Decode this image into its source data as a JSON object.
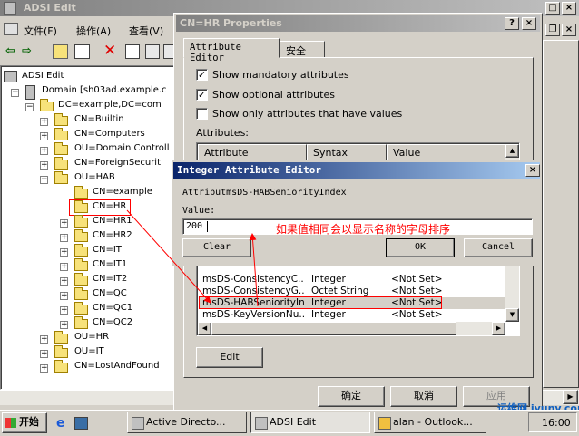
{
  "main_window": {
    "title": "ADSI Edit",
    "menu": [
      {
        "label": "文件(F)"
      },
      {
        "label": "操作(A)"
      },
      {
        "label": "查看(V)"
      }
    ],
    "tree": {
      "root": "ADSI Edit",
      "domain": "Domain [sh03ad.example.c",
      "dc": "DC=example,DC=com",
      "items": [
        "CN=Builtin",
        "CN=Computers",
        "OU=Domain Controll",
        "CN=ForeignSecurit",
        "OU=HAB"
      ],
      "hab_children": [
        "CN=example",
        "CN=HR",
        "CN=HR1",
        "CN=HR2",
        "CN=IT",
        "CN=IT1",
        "CN=IT2",
        "CN=QC",
        "CN=QC1",
        "CN=QC2"
      ],
      "after": [
        "OU=HR",
        "OU=IT",
        "CN=LostAndFound"
      ]
    }
  },
  "properties_dialog": {
    "title": "CN=HR Properties",
    "tabs": [
      "Attribute Editor",
      "安全"
    ],
    "checks": [
      {
        "label": "Show mandatory attributes",
        "checked": true
      },
      {
        "label": "Show optional attributes",
        "checked": true
      },
      {
        "label": "Show only attributes that have values",
        "checked": false
      }
    ],
    "attributes_label": "Attributes:",
    "columns": [
      "Attribute",
      "Syntax",
      "Value"
    ],
    "rows": [
      {
        "attr": "msDS-ConsistencyC...",
        "syntax": "Integer",
        "value": "<Not Set>"
      },
      {
        "attr": "msDS-ConsistencyG...",
        "syntax": "Octet String",
        "value": "<Not Set>"
      },
      {
        "attr": "msDS-HABSeniorityIn...",
        "syntax": "Integer",
        "value": "<Not Set>"
      },
      {
        "attr": "msDS-KeyVersionNu...",
        "syntax": "Integer",
        "value": "<Not Set>"
      }
    ],
    "edit_label": "Edit",
    "ok_label": "确定",
    "cancel_label": "取消",
    "apply_label": "应用"
  },
  "int_editor": {
    "title": "Integer Attribute Editor",
    "attribute_line": "AttributmsDS-HABSeniorityIndex",
    "value_label": "Value:",
    "value": "200",
    "clear_label": "Clear",
    "ok_label": "OK",
    "cancel_label": "Cancel"
  },
  "annotation": {
    "text": "如果值相同会以显示名称的字母排序",
    "color": "#ff0000"
  },
  "taskbar": {
    "start": "开始",
    "buttons": [
      "Active Directo...",
      "ADSI Edit",
      "alan - Outlook..."
    ],
    "clock": "16:00"
  },
  "watermark": "运维网 iyunv.com"
}
